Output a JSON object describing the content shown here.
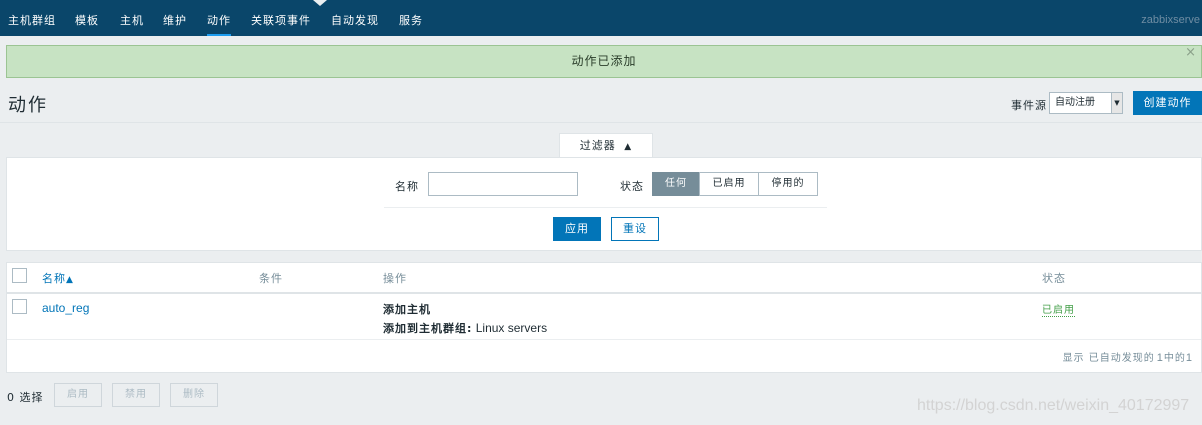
{
  "nav": {
    "items": [
      "主机群组",
      "模板",
      "主机",
      "维护",
      "动作",
      "关联项事件",
      "自动发现",
      "服务"
    ],
    "active_index": 4,
    "server": "zabbixserve"
  },
  "message": {
    "text": "动作已添加",
    "close": "×"
  },
  "header": {
    "title": "动作",
    "event_source_label": "事件源",
    "event_source_value": "自动注册",
    "create_button": "创建动作"
  },
  "filter": {
    "tab_label": "过滤器",
    "tab_arrow": "▲",
    "name_label": "名称",
    "name_value": "",
    "status_label": "状态",
    "status_options": [
      "任何",
      "已启用",
      "停用的"
    ],
    "status_selected": 0,
    "apply": "应用",
    "reset": "重设"
  },
  "table": {
    "headers": {
      "name": "名称",
      "sort_arrow": "▲",
      "conditions": "条件",
      "operations": "操作",
      "status": "状态"
    },
    "rows": [
      {
        "name": "auto_reg",
        "conditions": "",
        "operations": [
          {
            "label": "添加主机",
            "value": ""
          },
          {
            "label": "添加到主机群组:",
            "value": " Linux servers"
          }
        ],
        "status": "已启用"
      }
    ],
    "footer_prefix": "显示 已自动发现的",
    "footer_count": "1",
    "footer_mid": "中的",
    "footer_total": "1"
  },
  "bottom": {
    "selected_count": "0",
    "selected_label": "选择",
    "buttons": [
      "启用",
      "禁用",
      "删除"
    ]
  },
  "watermark": "https://blog.csdn.net/weixin_40172997",
  "colors": {
    "nav_bg": "#0a466a",
    "primary": "#0275b8",
    "success_bg": "#c7e3c3",
    "enabled": "#429e47"
  }
}
